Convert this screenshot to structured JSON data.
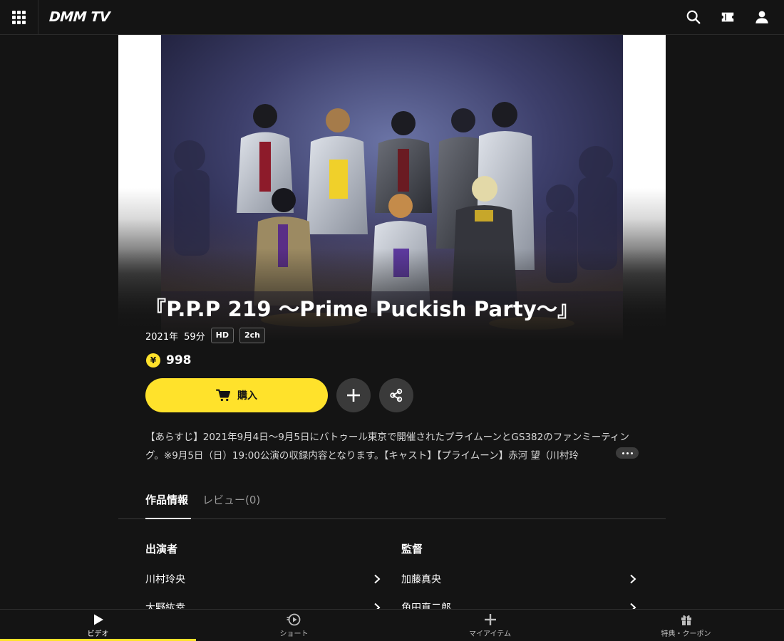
{
  "header": {
    "logo": "DMM TV",
    "icons": [
      "menu-grid-icon",
      "search-icon",
      "ticket-icon",
      "user-icon"
    ]
  },
  "title": {
    "main": "『P.P.P 219 ～Prime Puckish Party～』",
    "year": "2021年",
    "duration": "59分",
    "tags": [
      "HD",
      "2ch"
    ]
  },
  "price": {
    "symbol": "¥",
    "amount": "998"
  },
  "actions": {
    "buy_label": "購入"
  },
  "synopsis": "【あらすじ】2021年9月4日～9月5日にバトゥール東京で開催されたプライムーンとGS382のファンミーティング。※9月5日（日）19:00公演の収録内容となります。【キャスト】【プライムーン】赤河 望（川村玲",
  "tabs": [
    {
      "label": "作品情報"
    },
    {
      "label": "レビュー(0)"
    }
  ],
  "credits": {
    "cast": {
      "title": "出演者",
      "names": [
        "川村玲央",
        "大野紘幸"
      ]
    },
    "director": {
      "title": "監督",
      "names": [
        "加藤真央",
        "角田直二郎"
      ]
    }
  },
  "bottom_nav": [
    {
      "label": "ビデオ",
      "icon": "play-icon"
    },
    {
      "label": "ショート",
      "icon": "short-video-icon"
    },
    {
      "label": "マイアイテム",
      "icon": "plus-icon"
    },
    {
      "label": "特典・クーポン",
      "icon": "gift-icon"
    }
  ],
  "colors": {
    "accent": "#ffe22b",
    "background": "#141414"
  }
}
